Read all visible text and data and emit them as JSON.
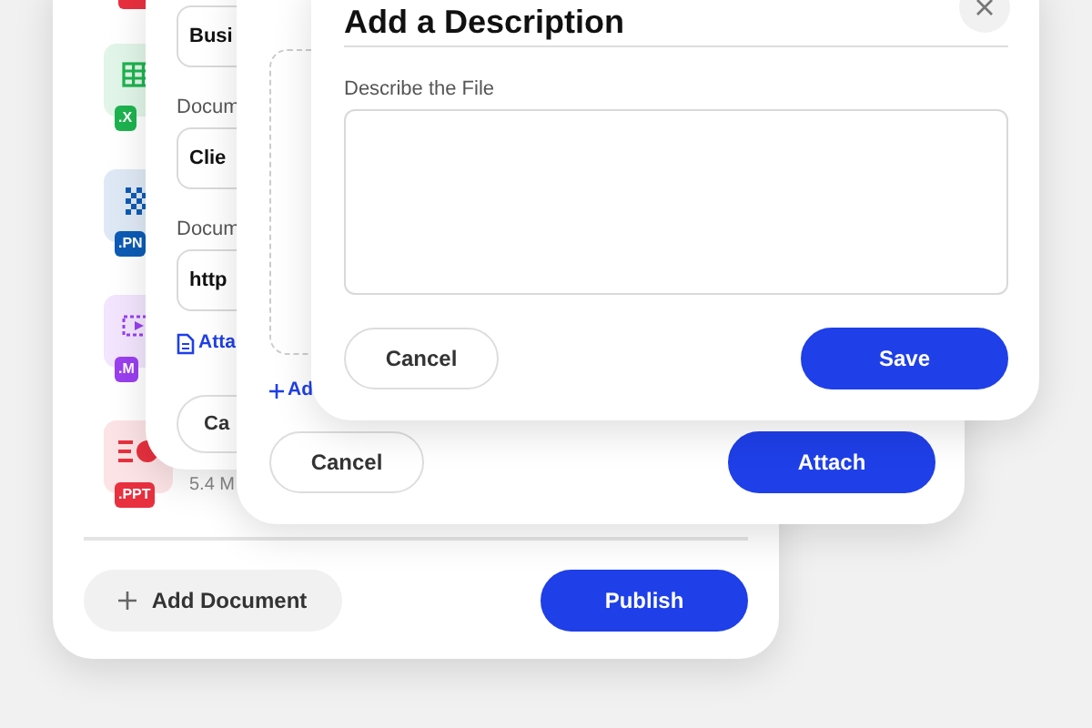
{
  "documents": {
    "files": [
      {
        "kind": "cut",
        "color": "#e8303f"
      },
      {
        "kind": "spreadsheet",
        "type": ".X",
        "color": "#1db34f"
      },
      {
        "kind": "image",
        "type": ".PN",
        "color": "#0d5bb5"
      },
      {
        "kind": "video",
        "type": ".M",
        "color": "#9a3ff0"
      },
      {
        "kind": "presentation",
        "type": ".PPT",
        "color": "#e8303f",
        "size": "5.4 M"
      }
    ],
    "add_button": "Add Document",
    "publish_button": "Publish"
  },
  "link_form": {
    "fields": [
      {
        "value": "Busi"
      },
      {
        "label": "Docum",
        "value": "Clie"
      },
      {
        "label": "Docum",
        "value": "http"
      }
    ],
    "attach_link": "Atta",
    "cancel_button": "Ca"
  },
  "upload_dialog": {
    "add_link": "Ad",
    "cancel_button": "Cancel",
    "attach_button": "Attach"
  },
  "description_dialog": {
    "title": "Add a Description",
    "field_label": "Describe the File",
    "cancel_button": "Cancel",
    "save_button": "Save"
  }
}
